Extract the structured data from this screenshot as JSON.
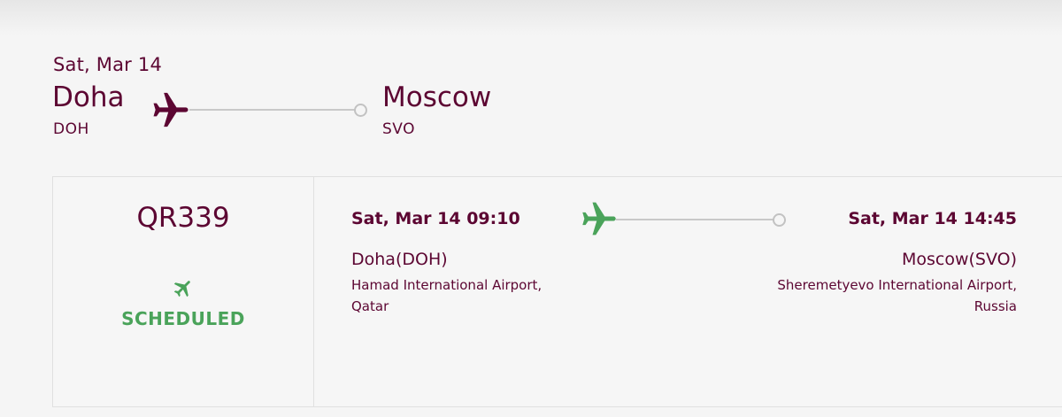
{
  "route": {
    "date": "Sat, Mar 14",
    "origin_city": "Doha",
    "origin_code": "DOH",
    "destination_city": "Moscow",
    "destination_code": "SVO",
    "plane_icon": "airplane-icon"
  },
  "flight": {
    "number": "QR339",
    "status": "SCHEDULED",
    "status_icon": "airplane-icon",
    "departure": {
      "datetime": "Sat, Mar 14 09:10",
      "city": "Doha(DOH)",
      "airport_line1": "Hamad International Airport,",
      "airport_line2": "Qatar"
    },
    "arrival": {
      "datetime": "Sat, Mar 14 14:45",
      "city": "Moscow(SVO)",
      "airport_line1": "Sheremetyevo International Airport,",
      "airport_line2": "Russia"
    }
  },
  "colors": {
    "brand": "#5c0632",
    "status": "#4aa35a",
    "line": "#c9c9c9"
  }
}
